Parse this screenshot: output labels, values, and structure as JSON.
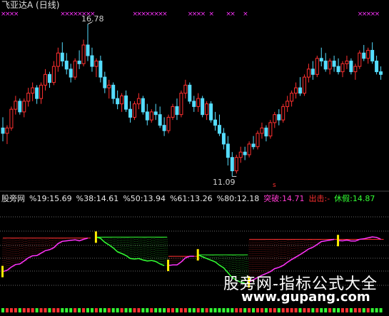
{
  "header": {
    "title": "飞亚达A (日线)"
  },
  "main_chart": {
    "high_label": "16.78",
    "low_label": "11.09",
    "colors": {
      "up": "#ff3030",
      "down": "#55ddff",
      "marker": "#ff33ff"
    },
    "candles": [
      [
        12.9,
        13.3,
        12.4,
        12.7
      ],
      [
        12.7,
        13.0,
        12.3,
        12.9
      ],
      [
        12.9,
        13.7,
        12.8,
        13.6
      ],
      [
        13.6,
        14.1,
        13.4,
        13.9
      ],
      [
        13.9,
        14.0,
        13.4,
        13.5
      ],
      [
        13.5,
        14.0,
        13.3,
        13.9
      ],
      [
        13.9,
        14.4,
        13.7,
        14.2
      ],
      [
        14.2,
        14.6,
        13.9,
        14.4
      ],
      [
        14.4,
        14.5,
        13.8,
        14.0
      ],
      [
        14.0,
        14.6,
        13.8,
        14.5
      ],
      [
        14.5,
        15.1,
        14.3,
        14.9
      ],
      [
        14.9,
        15.0,
        14.4,
        14.6
      ],
      [
        14.6,
        15.4,
        14.5,
        15.2
      ],
      [
        15.2,
        15.9,
        15.0,
        15.7
      ],
      [
        15.7,
        16.1,
        15.2,
        15.4
      ],
      [
        15.4,
        15.7,
        14.9,
        15.1
      ],
      [
        15.1,
        15.3,
        14.6,
        14.8
      ],
      [
        14.8,
        15.5,
        14.7,
        15.4
      ],
      [
        15.4,
        15.8,
        15.1,
        15.3
      ],
      [
        15.3,
        16.2,
        15.2,
        16.0
      ],
      [
        16.0,
        16.78,
        15.4,
        15.6
      ],
      [
        15.6,
        15.9,
        15.0,
        15.2
      ],
      [
        15.2,
        15.5,
        14.8,
        15.4
      ],
      [
        15.4,
        15.6,
        14.6,
        14.8
      ],
      [
        14.8,
        15.0,
        14.2,
        14.4
      ],
      [
        14.4,
        14.7,
        14.0,
        14.5
      ],
      [
        14.5,
        14.6,
        13.8,
        14.0
      ],
      [
        14.0,
        14.3,
        13.6,
        13.8
      ],
      [
        13.8,
        14.2,
        13.5,
        14.1
      ],
      [
        14.1,
        14.3,
        13.5,
        13.6
      ],
      [
        13.6,
        13.9,
        13.1,
        13.3
      ],
      [
        13.3,
        13.9,
        13.2,
        13.8
      ],
      [
        13.8,
        14.2,
        13.6,
        14.0
      ],
      [
        14.0,
        14.1,
        13.4,
        13.5
      ],
      [
        13.5,
        13.8,
        13.0,
        13.2
      ],
      [
        13.2,
        13.6,
        13.1,
        13.5
      ],
      [
        13.5,
        13.8,
        13.2,
        13.4
      ],
      [
        13.4,
        13.7,
        12.9,
        13.0
      ],
      [
        13.0,
        13.3,
        12.6,
        12.8
      ],
      [
        12.8,
        13.4,
        12.7,
        13.3
      ],
      [
        13.3,
        13.8,
        13.2,
        13.7
      ],
      [
        13.7,
        14.0,
        13.2,
        13.4
      ],
      [
        13.4,
        14.3,
        13.3,
        14.2
      ],
      [
        14.2,
        14.7,
        14.0,
        14.5
      ],
      [
        14.5,
        14.6,
        13.8,
        13.9
      ],
      [
        13.9,
        14.1,
        13.5,
        13.7
      ],
      [
        13.7,
        14.2,
        13.5,
        14.0
      ],
      [
        14.0,
        14.1,
        13.3,
        13.4
      ],
      [
        13.4,
        13.9,
        13.2,
        13.8
      ],
      [
        13.8,
        13.9,
        13.1,
        13.2
      ],
      [
        13.2,
        13.5,
        12.8,
        13.0
      ],
      [
        13.0,
        13.4,
        12.6,
        12.7
      ],
      [
        12.7,
        12.9,
        12.1,
        12.3
      ],
      [
        12.3,
        12.6,
        11.5,
        11.8
      ],
      [
        11.8,
        12.0,
        11.09,
        11.3
      ],
      [
        11.3,
        11.9,
        11.2,
        11.8
      ],
      [
        11.8,
        12.2,
        11.6,
        12.0
      ],
      [
        12.0,
        12.2,
        11.7,
        11.9
      ],
      [
        11.9,
        12.4,
        11.8,
        12.3
      ],
      [
        12.3,
        12.6,
        12.1,
        12.2
      ],
      [
        12.2,
        12.8,
        12.1,
        12.7
      ],
      [
        12.7,
        13.1,
        12.5,
        12.9
      ],
      [
        12.9,
        13.0,
        12.4,
        12.6
      ],
      [
        12.6,
        13.2,
        12.5,
        13.1
      ],
      [
        13.1,
        13.5,
        12.9,
        13.4
      ],
      [
        13.4,
        13.6,
        13.0,
        13.2
      ],
      [
        13.2,
        13.8,
        13.1,
        13.7
      ],
      [
        13.7,
        14.1,
        13.5,
        13.9
      ],
      [
        13.9,
        14.3,
        13.7,
        14.2
      ],
      [
        14.2,
        14.6,
        14.0,
        14.4
      ],
      [
        14.4,
        14.8,
        14.1,
        14.2
      ],
      [
        14.2,
        14.9,
        14.1,
        14.8
      ],
      [
        14.8,
        15.3,
        14.6,
        15.1
      ],
      [
        15.1,
        15.4,
        14.7,
        14.9
      ],
      [
        14.9,
        15.6,
        14.8,
        15.5
      ],
      [
        15.5,
        15.9,
        15.2,
        15.4
      ],
      [
        15.4,
        15.7,
        15.0,
        15.1
      ],
      [
        15.1,
        15.5,
        14.9,
        15.4
      ],
      [
        15.4,
        15.6,
        15.0,
        15.2
      ],
      [
        15.2,
        15.5,
        14.9,
        15.0
      ],
      [
        15.0,
        15.4,
        14.8,
        15.3
      ],
      [
        15.3,
        15.6,
        15.1,
        15.4
      ],
      [
        15.4,
        15.5,
        14.9,
        15.0
      ],
      [
        15.0,
        15.3,
        14.7,
        15.2
      ],
      [
        15.2,
        15.8,
        15.1,
        15.7
      ],
      [
        15.7,
        16.0,
        15.4,
        15.5
      ],
      [
        15.5,
        15.9,
        15.3,
        15.8
      ],
      [
        15.8,
        16.1,
        15.3,
        15.4
      ],
      [
        15.4,
        15.6,
        14.9,
        15.0
      ],
      [
        15.0,
        15.2,
        14.7,
        14.9
      ]
    ]
  },
  "indicator": {
    "name": "股旁网",
    "levels": [
      {
        "label": "%19:15.69"
      },
      {
        "label": "%38:14.61"
      },
      {
        "label": "%50:13.94"
      },
      {
        "label": "%61:13.26"
      },
      {
        "label": "%80:12.18"
      }
    ],
    "tupo": "突破:14.71",
    "chuji": "出击:-",
    "xiujia": "休假:14.87"
  },
  "watermark": {
    "text": "股旁网-指标公式大全",
    "url": "www.gupang.com"
  }
}
